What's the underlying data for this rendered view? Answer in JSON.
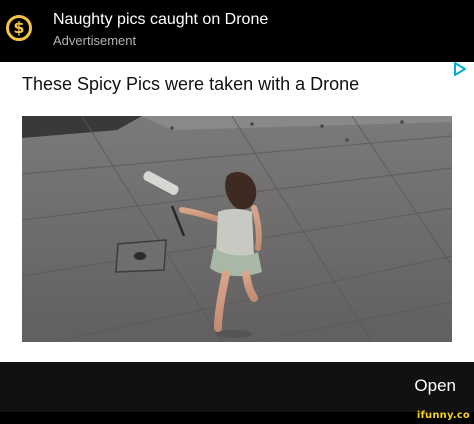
{
  "ad": {
    "coin_icon": "$",
    "title": "Naughty pics caught on Drone",
    "subtitle": "Advertisement",
    "headline": "These Spicy Pics were taken with a Drone",
    "open_label": "Open",
    "adchoices_icon": "play-triangle-icon"
  },
  "watermark": "ifunny.co",
  "colors": {
    "background": "#000000",
    "card": "#ffffff",
    "coin": "#f5c242",
    "adchoices": "#00aecd",
    "watermark": "#f7d117"
  }
}
